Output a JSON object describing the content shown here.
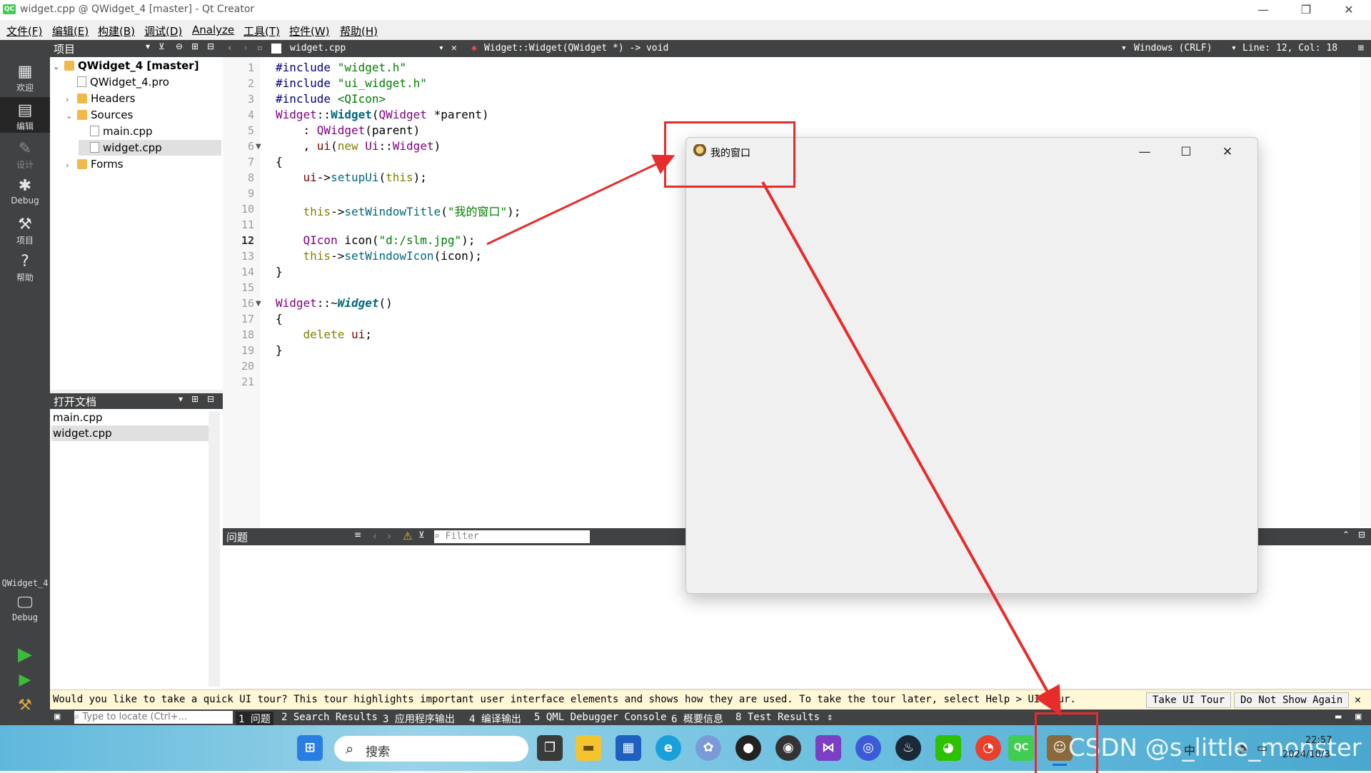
{
  "window": {
    "title": "widget.cpp @ QWidget_4 [master] - Qt Creator",
    "app_logo": "QC",
    "min": "—",
    "max": "❐",
    "close": "✕"
  },
  "menu": [
    "文件(F)",
    "编辑(E)",
    "构建(B)",
    "调试(D)",
    "Analyze",
    "工具(T)",
    "控件(W)",
    "帮助(H)"
  ],
  "modes": {
    "welcome": "欢迎",
    "edit": "编辑",
    "design": "设计",
    "debug": "Debug",
    "projects": "项目",
    "help": "帮助",
    "kit_project": "QWidget_4",
    "kit_config": "Debug"
  },
  "project_panel": {
    "title": "项目",
    "tree": [
      "QWidget_4 [master]",
      "QWidget_4.pro",
      "Headers",
      "Sources",
      "main.cpp",
      "widget.cpp",
      "Forms"
    ]
  },
  "open_docs": {
    "title": "打开文档",
    "items": [
      "main.cpp",
      "widget.cpp"
    ]
  },
  "editor_bar": {
    "file": "widget.cpp",
    "symbol": "Widget::Widget(QWidget *) -> void",
    "line_endings": "Windows (CRLF)",
    "position": "Line: 12, Col: 18"
  },
  "code": {
    "line_numbers": [
      "1",
      "2",
      "3",
      "4",
      "5",
      "6",
      "7",
      "8",
      "9",
      "10",
      "11",
      "12",
      "13",
      "14",
      "15",
      "16",
      "17",
      "18",
      "19",
      "20",
      "21"
    ],
    "l1a": "#include ",
    "l1b": "\"widget.h\"",
    "l2a": "#include ",
    "l2b": "\"ui_widget.h\"",
    "l3a": "#include ",
    "l3b": "<QIcon>",
    "l4a": "Widget",
    "l4b": "::",
    "l4c": "Widget",
    "l4d": "(",
    "l4e": "QWidget",
    "l4f": " *parent)",
    "l5a": "    : ",
    "l5b": "QWidget",
    "l5c": "(parent)",
    "l6a": "    , ",
    "l6b": "ui",
    "l6c": "(",
    "l6d": "new",
    "l6e": " ",
    "l6f": "Ui",
    "l6g": "::",
    "l6h": "Widget",
    "l6i": ")",
    "l7": "{",
    "l8a": "    ",
    "l8b": "ui",
    "l8c": "->",
    "l8d": "setupUi",
    "l8e": "(",
    "l8f": "this",
    "l8g": ");",
    "l10a": "    ",
    "l10b": "this",
    "l10c": "->",
    "l10d": "setWindowTitle",
    "l10e": "(",
    "l10f": "\"我的窗口\"",
    "l10g": ");",
    "l12a": "    ",
    "l12b": "QIcon",
    "l12c": " icon(",
    "l12d": "\"d:/slm.jpg\"",
    "l12e": ");",
    "l13a": "    ",
    "l13b": "this",
    "l13c": "->",
    "l13d": "setWindowIcon",
    "l13e": "(icon);",
    "l14": "}",
    "l16a": "Widget",
    "l16b": "::~",
    "l16c": "Widget",
    "l16d": "()",
    "l17": "{",
    "l18a": "    ",
    "l18b": "delete",
    "l18c": " ",
    "l18d": "ui",
    "l18e": ";",
    "l19": "}"
  },
  "issues": {
    "title": "问题",
    "filter_placeholder": "Filter"
  },
  "tour": {
    "message": "Would you like to take a quick UI tour? This tour highlights important user interface elements and shows how they are used. To take the tour later, select Help > UI Tour.",
    "take": "Take UI Tour",
    "dismiss": "Do Not Show Again"
  },
  "output_bar": {
    "locate_placeholder": "Type to locate (Ctrl+...",
    "tabs": [
      "1 问题",
      "2 Search Results",
      "3 应用程序输出",
      "4 编译输出",
      "5 QML Debugger Console",
      "6 概要信息",
      "8 Test Results"
    ]
  },
  "taskbar": {
    "search": "搜索",
    "watermark": "CSDN @s_little_monster",
    "time": "22:57",
    "date": "2024/10/3",
    "ime": "中"
  },
  "app_window": {
    "title": "我的窗口"
  }
}
